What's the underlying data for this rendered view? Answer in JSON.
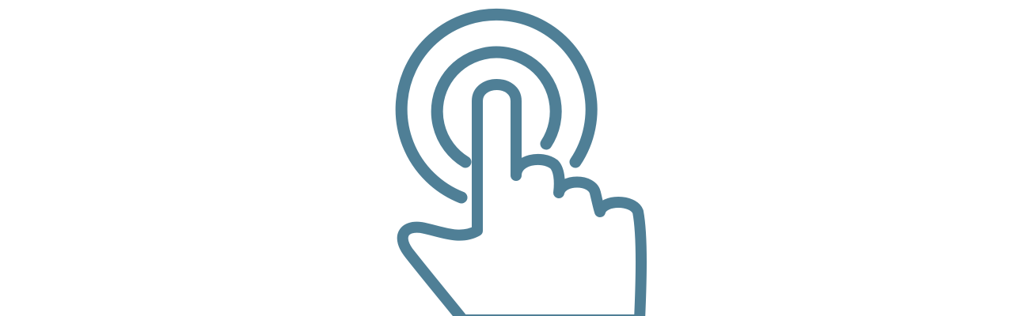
{
  "icon": {
    "name": "tap-gesture-icon",
    "color": "#4f7f96",
    "background": "#ffffff"
  }
}
